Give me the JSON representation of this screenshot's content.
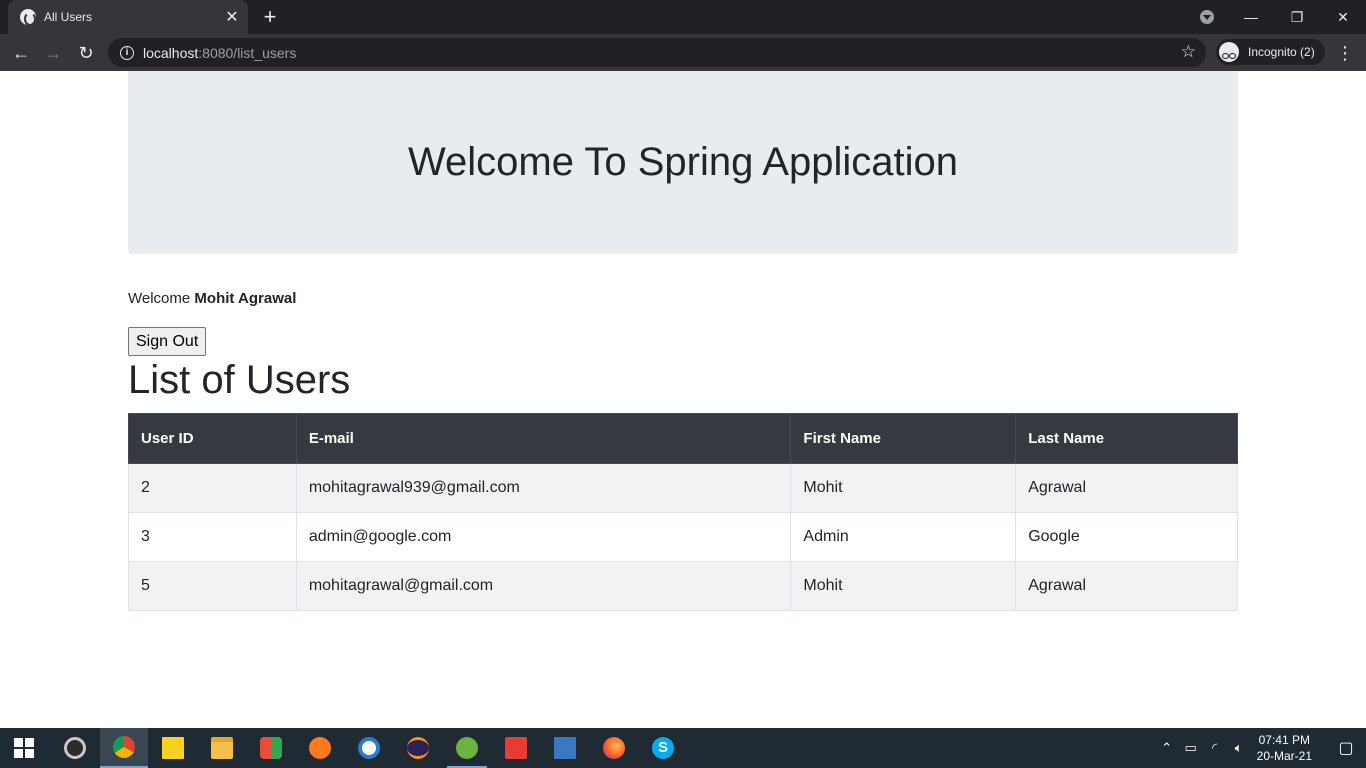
{
  "browser": {
    "tab_title": "All Users",
    "url_host": "localhost",
    "url_rest": ":8080/list_users",
    "incognito_label": "Incognito (2)"
  },
  "page": {
    "jumbotron_title": "Welcome To Spring Application",
    "welcome_prefix": "Welcome",
    "welcome_name": "Mohit Agrawal",
    "signout_label": "Sign Out",
    "list_title": "List of Users"
  },
  "table": {
    "headers": [
      "User ID",
      "E-mail",
      "First Name",
      "Last Name"
    ],
    "rows": [
      [
        "2",
        "mohitagrawal939@gmail.com",
        "Mohit",
        "Agrawal"
      ],
      [
        "3",
        "admin@google.com",
        "Admin",
        "Google"
      ],
      [
        "5",
        "mohitagrawal@gmail.com",
        "Mohit",
        "Agrawal"
      ]
    ]
  },
  "taskbar": {
    "apps": [
      "start",
      "media-player",
      "chrome",
      "sticky-notes",
      "file-explorer",
      "office-app",
      "sublime-text",
      "app-w",
      "eclipse",
      "spring-tool-suite",
      "git-tool",
      "remote-desktop",
      "firefox",
      "skype"
    ],
    "time": "07:41 PM",
    "date": "20-Mar-21"
  }
}
